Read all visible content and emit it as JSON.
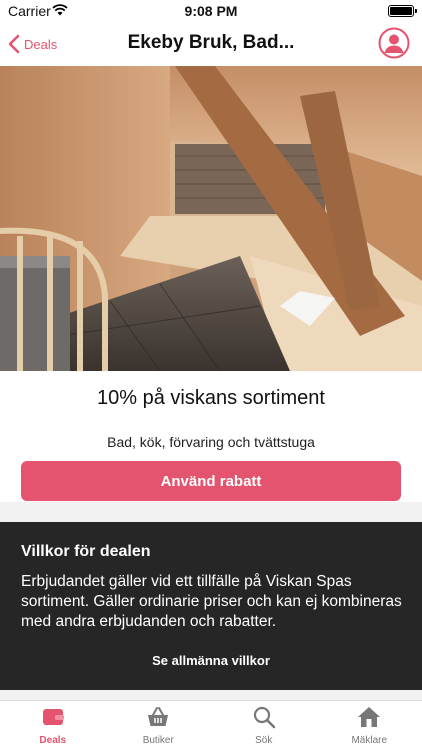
{
  "status": {
    "carrier": "Carrier",
    "time": "9:08 PM"
  },
  "nav": {
    "back_label": "Deals",
    "title": "Ekeby Bruk, Bad..."
  },
  "deal": {
    "title": "10% på viskans sortiment",
    "subtitle": "Bad, kök, förvaring och tvättstuga",
    "button_label": "Använd rabatt"
  },
  "terms": {
    "heading": "Villkor för dealen",
    "body": "Erbjudandet gäller vid ett tillfälle på Viskan Spas sortiment. Gäller ordinarie priser och kan ej kombineras med andra erbjudanden och rabatter.",
    "link_label": "Se allmänna villkor"
  },
  "tabs": [
    {
      "label": "Deals",
      "icon": "wallet-icon",
      "active": true
    },
    {
      "label": "Butiker",
      "icon": "basket-icon",
      "active": false
    },
    {
      "label": "Sök",
      "icon": "search-icon",
      "active": false
    },
    {
      "label": "Mäklare",
      "icon": "house-icon",
      "active": false
    }
  ],
  "colors": {
    "accent": "#e5546f",
    "dark_panel": "#262626"
  }
}
